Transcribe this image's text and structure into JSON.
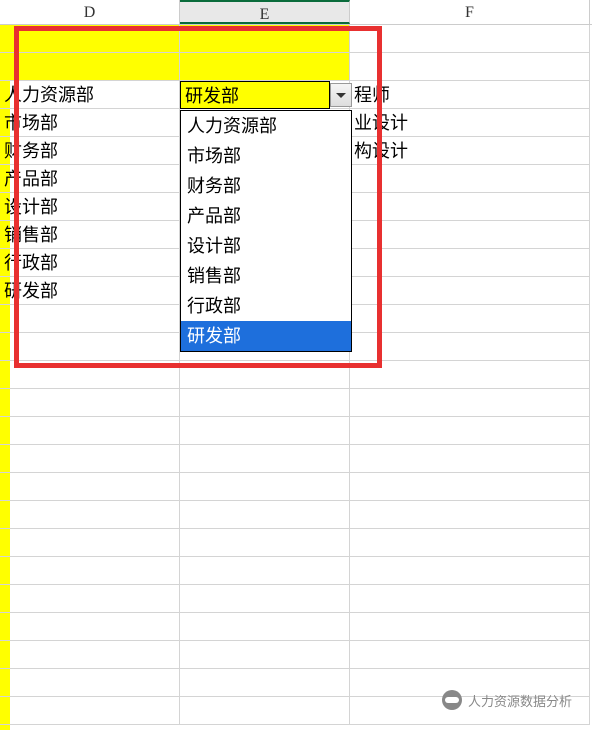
{
  "columns": {
    "d": "D",
    "e": "E",
    "f": "F"
  },
  "departments": [
    "人力资源部",
    "市场部",
    "财务部",
    "产品部",
    "设计部",
    "销售部",
    "行政部",
    "研发部"
  ],
  "col_f_visible": [
    "程师",
    "业设计",
    "构设计"
  ],
  "selected_value": "研发部",
  "dropdown_options": [
    "人力资源部",
    "市场部",
    "财务部",
    "产品部",
    "设计部",
    "销售部",
    "行政部",
    "研发部"
  ],
  "dropdown_selected_index": 7,
  "watermark": "人力资源数据分析"
}
